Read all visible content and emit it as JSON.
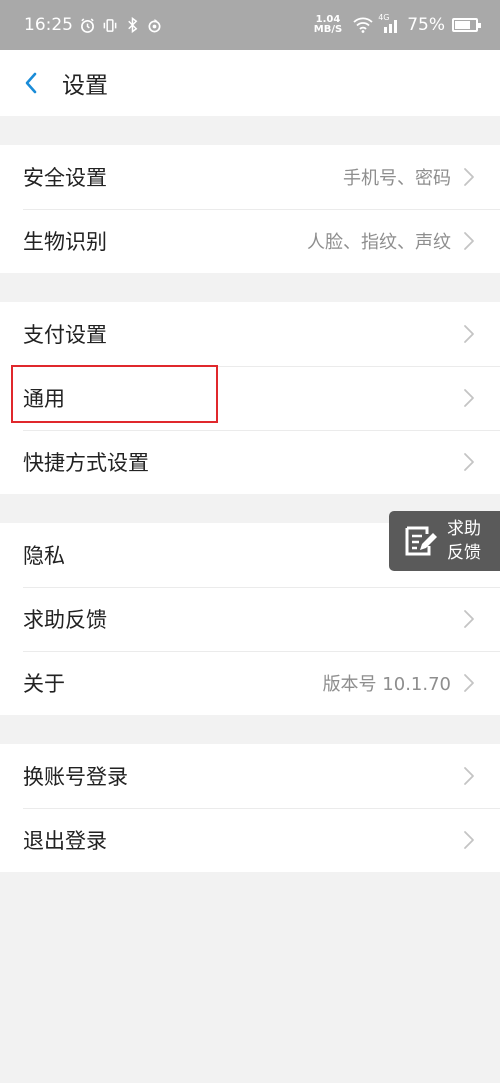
{
  "status_bar": {
    "time": "16:25",
    "net_speed_value": "1.04",
    "net_speed_unit": "MB/S",
    "network": "4G",
    "battery": "75%",
    "battery_level": 0.75
  },
  "nav": {
    "title": "设置"
  },
  "groups": [
    [
      {
        "label": "安全设置",
        "value": "手机号、密码"
      },
      {
        "label": "生物识别",
        "value": "人脸、指纹、声纹"
      }
    ],
    [
      {
        "label": "支付设置",
        "value": ""
      },
      {
        "label": "通用",
        "value": ""
      },
      {
        "label": "快捷方式设置",
        "value": ""
      }
    ],
    [
      {
        "label": "隐私",
        "value": ""
      },
      {
        "label": "求助反馈",
        "value": ""
      },
      {
        "label": "关于",
        "value": "版本号 10.1.70"
      }
    ],
    [
      {
        "label": "换账号登录",
        "value": ""
      },
      {
        "label": "退出登录",
        "value": ""
      }
    ]
  ],
  "floating": {
    "line1": "求助",
    "line2": "反馈"
  },
  "colors": {
    "highlight": "#e0282c",
    "accent": "#1a8cd8"
  }
}
